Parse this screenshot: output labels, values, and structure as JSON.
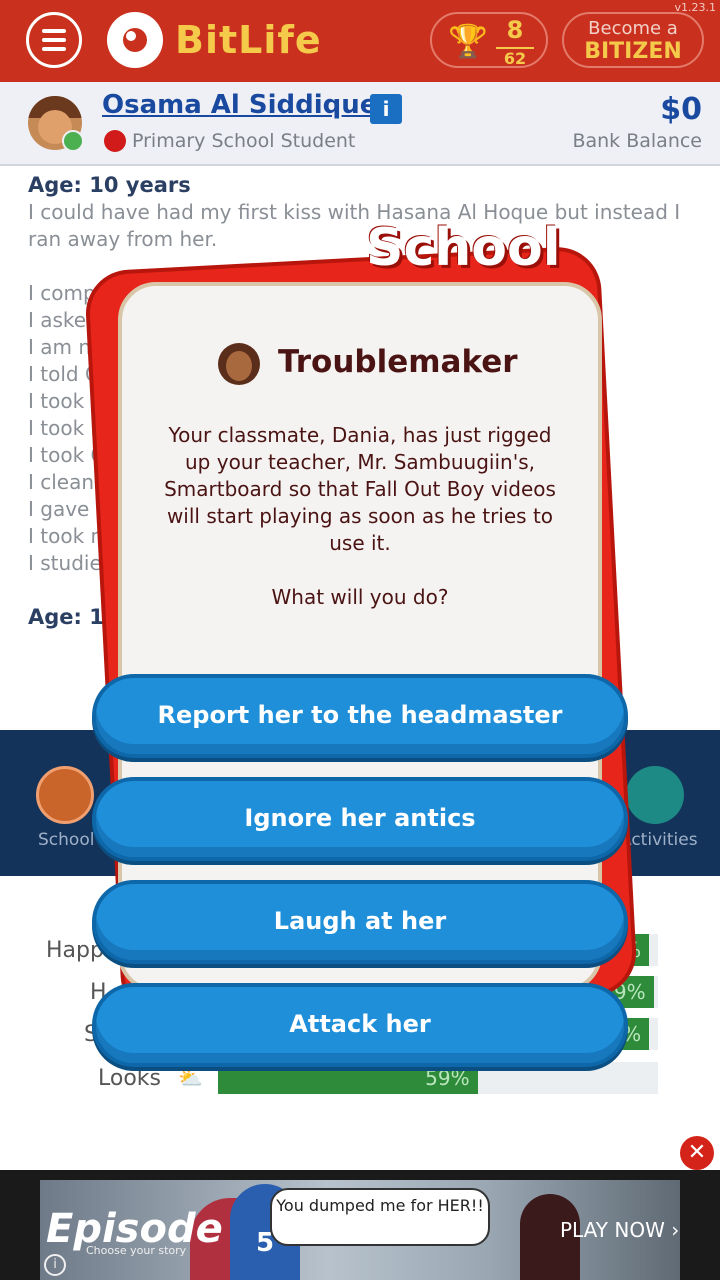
{
  "app": {
    "version": "v1.23.1",
    "logo_text": "BitLife",
    "trophies": {
      "earned": "8",
      "total": "62"
    },
    "bitizen": {
      "line1": "Become a",
      "line2": "BITIZEN"
    }
  },
  "profile": {
    "name": "Osama Al Siddique",
    "occupation": "Primary School Student",
    "balance": "$0",
    "balance_label": "Bank Balance"
  },
  "feed": {
    "age_header": "Age: 10 years",
    "intro": "I could have had my first kiss with Hasana Al Hoque but instead I ran away from her.",
    "lines": [
      "I complin",
      "I asked",
      "I am no",
      "I told G",
      "I took m",
      "I took m",
      "I took G",
      "I cleane",
      "I gave m",
      "I took m",
      "I studie"
    ],
    "next_age": "Age: 1"
  },
  "nav": {
    "school_label": "School",
    "activities_label": "Activities"
  },
  "stats": [
    {
      "label": "Happ",
      "value": 98,
      "text": "%"
    },
    {
      "label": "H",
      "value": 99,
      "text": "9%"
    },
    {
      "label": "S",
      "value": 98,
      "text": "%"
    },
    {
      "label": "Looks",
      "value": 59,
      "text": "59%"
    }
  ],
  "modal": {
    "category": "School",
    "heading": "Troublemaker",
    "body": "Your classmate, Dania, has just rigged up your teacher, Mr. Sambuugiin's, Smartboard so that Fall Out Boy videos will start playing as soon as he tries to use it.",
    "question": "What will you do?",
    "choices": [
      "Report her to the headmaster",
      "Ignore her antics",
      "Laugh at her",
      "Attack her"
    ]
  },
  "ad": {
    "brand": "Episode",
    "tagline": "Choose your story",
    "speech": "You dumped me for HER!!",
    "cta": "PLAY NOW ›",
    "close": "✕",
    "jersey": "5"
  },
  "colors": {
    "topbar": "#c9311e",
    "accent_gold": "#f5c94a",
    "choice_blue": "#1f8fd9",
    "modal_red": "#e8251a"
  }
}
